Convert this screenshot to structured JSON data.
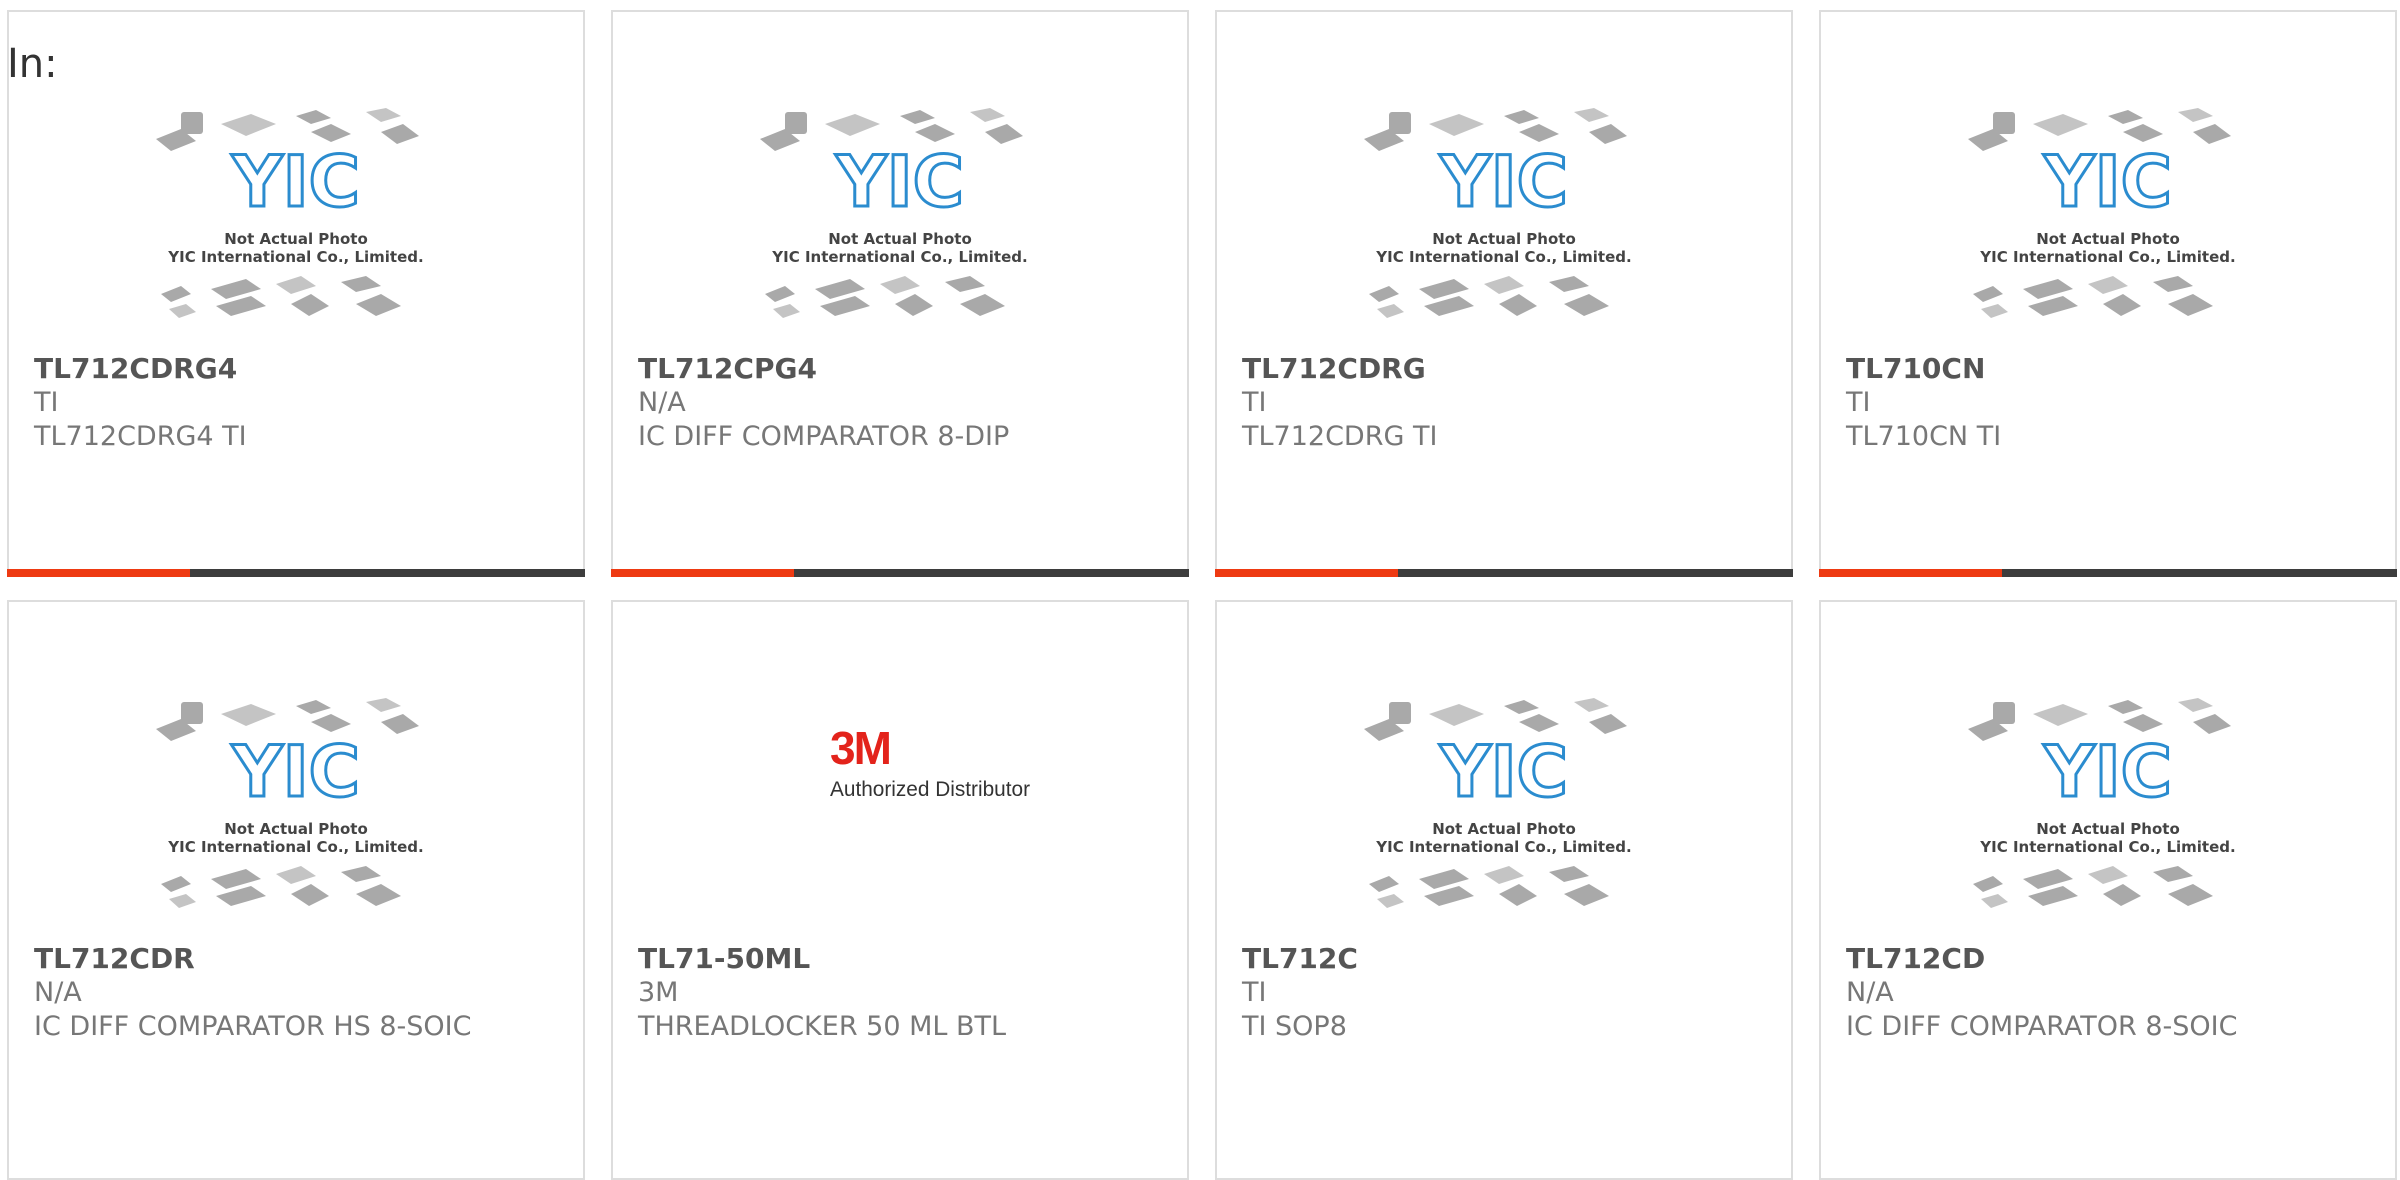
{
  "header": {
    "label": "In:"
  },
  "placeholder": {
    "logo_text": "YIC",
    "caption_line1": "Not Actual Photo",
    "caption_line2": "YIC International Co., Limited."
  },
  "brand_3m": {
    "logo_text": "3M",
    "tagline": "Authorized Distributor"
  },
  "colors": {
    "accent": "#ee3a12",
    "bar": "#3d3d3d",
    "yic_blue": "#2b8ccf"
  },
  "products": [
    {
      "part": "TL712CDRG4",
      "manufacturer": "TI",
      "description": "TL712CDRG4 TI",
      "image": "yic-placeholder",
      "bar": true
    },
    {
      "part": "TL712CPG4",
      "manufacturer": "N/A",
      "description": "IC DIFF COMPARATOR 8-DIP",
      "image": "yic-placeholder",
      "bar": true
    },
    {
      "part": "TL712CDRG",
      "manufacturer": "TI",
      "description": "TL712CDRG TI",
      "image": "yic-placeholder",
      "bar": true
    },
    {
      "part": "TL710CN",
      "manufacturer": "TI",
      "description": "TL710CN TI",
      "image": "yic-placeholder",
      "bar": true
    },
    {
      "part": "TL712CDR",
      "manufacturer": "N/A",
      "description": "IC DIFF COMPARATOR HS 8-SOIC",
      "image": "yic-placeholder",
      "bar": false
    },
    {
      "part": "TL71-50ML",
      "manufacturer": "3M",
      "description": "THREADLOCKER 50 ML BTL",
      "image": "3m-logo",
      "bar": false
    },
    {
      "part": "TL712C",
      "manufacturer": "TI",
      "description": "TI SOP8",
      "image": "yic-placeholder",
      "bar": false
    },
    {
      "part": "TL712CD",
      "manufacturer": "N/A",
      "description": "IC DIFF COMPARATOR 8-SOIC",
      "image": "yic-placeholder",
      "bar": false
    }
  ]
}
